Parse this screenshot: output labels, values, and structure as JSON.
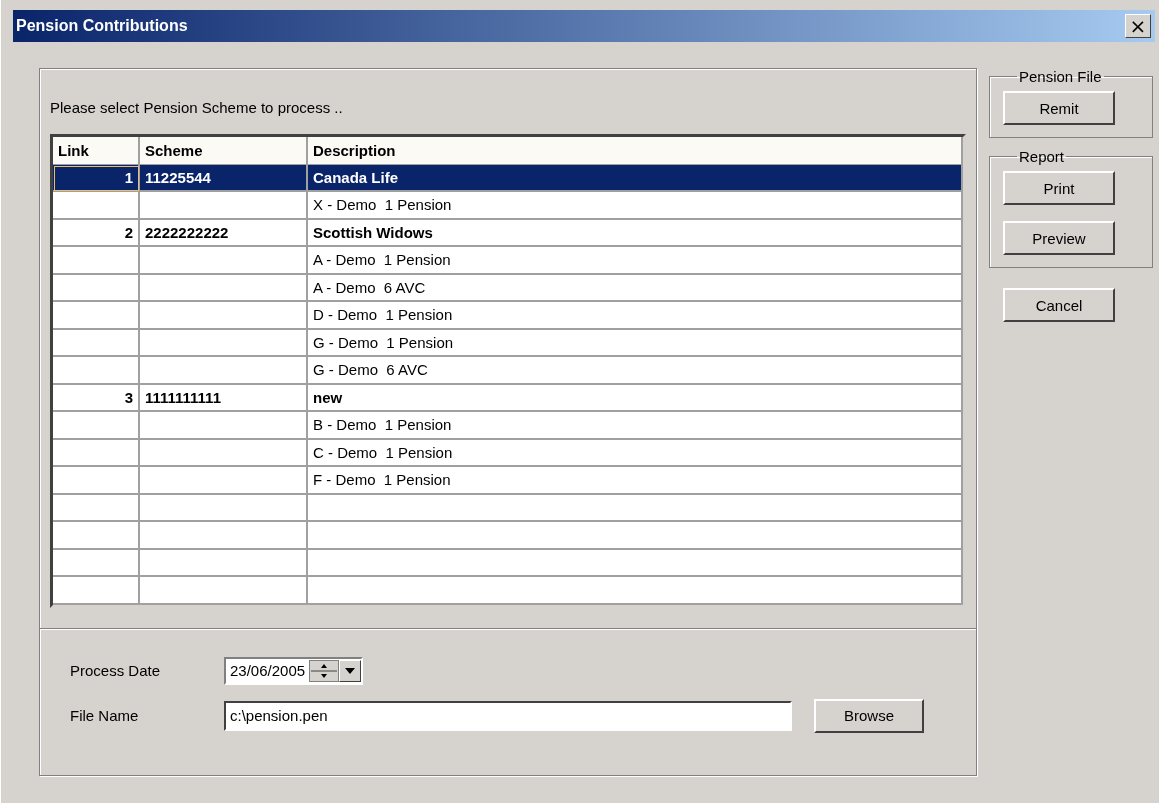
{
  "window": {
    "title": "Pension Contributions",
    "close": "×"
  },
  "prompt": "Please select Pension Scheme to process ..",
  "table": {
    "columns": [
      "Link",
      "Scheme",
      "Description"
    ],
    "rows": [
      {
        "kind": "scheme",
        "link": "1",
        "scheme": "11225544",
        "description": "Canada Life",
        "selected": true
      },
      {
        "kind": "item",
        "description": "X - Demo  1 Pension",
        "selected": false
      },
      {
        "kind": "scheme",
        "link": "2",
        "scheme": "2222222222",
        "description": "Scottish Widows",
        "selected": false
      },
      {
        "kind": "item",
        "description": "A - Demo  1 Pension",
        "selected": false
      },
      {
        "kind": "item",
        "description": "A - Demo  6 AVC",
        "selected": false
      },
      {
        "kind": "item",
        "description": "D - Demo  1 Pension",
        "selected": false
      },
      {
        "kind": "item",
        "description": "G - Demo  1 Pension",
        "selected": false
      },
      {
        "kind": "item",
        "description": "G - Demo  6 AVC",
        "selected": false
      },
      {
        "kind": "scheme",
        "link": "3",
        "scheme": "1111111111",
        "description": "new",
        "selected": false
      },
      {
        "kind": "item",
        "description": "B - Demo  1 Pension",
        "selected": false
      },
      {
        "kind": "item",
        "description": "C - Demo  1 Pension",
        "selected": false
      },
      {
        "kind": "item",
        "description": "F - Demo  1 Pension",
        "selected": false
      }
    ]
  },
  "process_date": {
    "label": "Process Date",
    "value": "23/06/2005"
  },
  "file_name": {
    "label": "File Name",
    "value": "c:\\pension.pen",
    "button": "Browse"
  },
  "groups": [
    {
      "title": "Pension File",
      "buttons": [
        "Remit"
      ]
    },
    {
      "title": "Report",
      "buttons": [
        "Print",
        "Preview"
      ]
    }
  ],
  "cancel": "Cancel"
}
